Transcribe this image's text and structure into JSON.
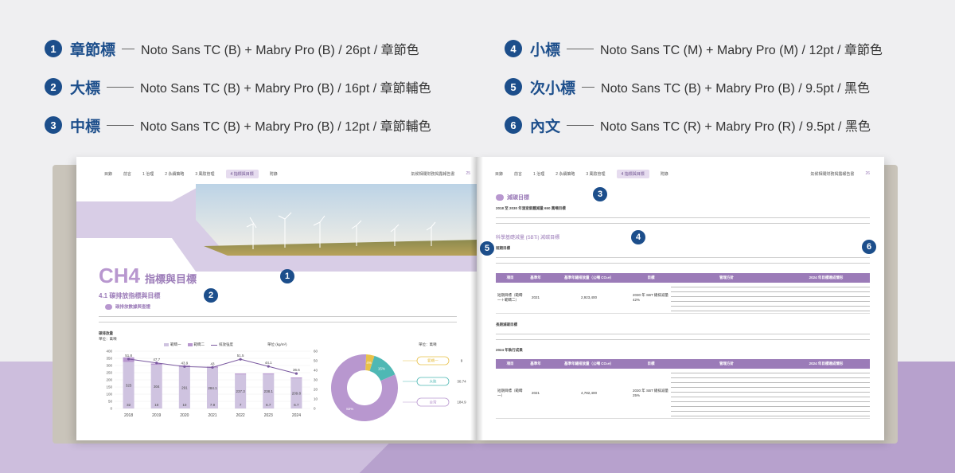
{
  "legend": [
    {
      "num": "1",
      "title": "章節標",
      "desc": "Noto Sans TC (B) + Mabry Pro (B) / 26pt / 章節色"
    },
    {
      "num": "2",
      "title": "大標",
      "desc": "Noto Sans TC (B) + Mabry Pro (B) / 16pt / 章節輔色"
    },
    {
      "num": "3",
      "title": "中標",
      "desc": "Noto Sans TC (B) + Mabry Pro (B) / 12pt / 章節輔色"
    },
    {
      "num": "4",
      "title": "小標",
      "desc": "Noto Sans TC (M) + Mabry Pro (M) / 12pt / 章節色"
    },
    {
      "num": "5",
      "title": "次小標",
      "desc": "Noto Sans TC (B) + Mabry Pro (B) / 9.5pt / 黑色"
    },
    {
      "num": "6",
      "title": "內文",
      "desc": "Noto Sans TC (R) + Mabry Pro (R) / 9.5pt / 黑色"
    }
  ],
  "left_page": {
    "nav": [
      "目錄",
      "前言",
      "1 治理",
      "2 永續策略",
      "3 風險管理",
      "4 指標與目標",
      "附錄"
    ],
    "nav_active": 5,
    "report_title": "氣候相關財務揭露報告書",
    "page_number": "25",
    "chapter_code": "CH4",
    "chapter_title": "指標與目標",
    "section_title": "4.1 碳排放指標與目標",
    "sub_section": "碳排放數據與查證",
    "chart_title": "碳排放量",
    "chart_unit": "單位：萬噸",
    "chart_unit_right": "單位 (kg/m²)",
    "pie_unit": "單位：萬噸",
    "legend_items": [
      "範疇一",
      "範疇二",
      "排放強度"
    ]
  },
  "chart_data": {
    "type": "bar",
    "categories": [
      "2018",
      "2019",
      "2020",
      "2021",
      "2022",
      "2023",
      "2024"
    ],
    "series": [
      {
        "name": "範疇一",
        "values": [
          32,
          10,
          10,
          7.9,
          7.0,
          6.7,
          6.7
        ]
      },
      {
        "name": "範疇二",
        "values": [
          325,
          304,
          291,
          284.1,
          237.3,
          238.1,
          209.8
        ]
      },
      {
        "name": "排放強度",
        "values": [
          51.8,
          47.7,
          43.9,
          43.0,
          51.5,
          44.1,
          36.6
        ]
      }
    ],
    "ylim": [
      0,
      400
    ],
    "y2lim": [
      0,
      60
    ],
    "yticks": [
      0,
      50,
      100,
      150,
      200,
      250,
      300,
      350,
      400
    ],
    "y2ticks": [
      0,
      10,
      20,
      30,
      40,
      50,
      60
    ],
    "pie": {
      "slices": [
        {
          "label": "範疇一",
          "value": 9,
          "color": "#e8c14a"
        },
        {
          "label": "大陸",
          "value": 30.74,
          "color": "#4fb8b4"
        },
        {
          "label": "台灣",
          "value": 184.9,
          "color": "#b897cf"
        }
      ],
      "pct_labels": [
        "4%",
        "15%",
        "82%"
      ]
    }
  },
  "right_page": {
    "nav": [
      "目錄",
      "前言",
      "1 治理",
      "2 永續策略",
      "3 風險管理",
      "4 指標與目標",
      "附錄"
    ],
    "nav_active": 5,
    "report_title": "氣候相關財務揭露報告書",
    "page_number": "26",
    "section_title": "減碳目標",
    "para_title": "2018 至 2030 年溫室氣體減量 650 萬噸目標",
    "subtitle": "科學基礎減量 (SBTi) 減碳目標",
    "item1_title": "短期目標",
    "item2_title": "長期減碳目標",
    "table_headers": [
      "項目",
      "基準年",
      "基準年總排放量（公噸 CO₂e）",
      "目標",
      "管理方針",
      "2024 年目標達成情形"
    ],
    "table1_row": [
      "短期目標（範疇一＋範疇二）",
      "2021",
      "2,923,400",
      "2030 年 SBT 總排減量 42%"
    ],
    "table2_row": [
      "短期目標（範疇一）",
      "2021",
      "4,782,400",
      "2030 年 SBT 總排減量 25%"
    ],
    "table2_caption": "2024 年執行成果"
  }
}
